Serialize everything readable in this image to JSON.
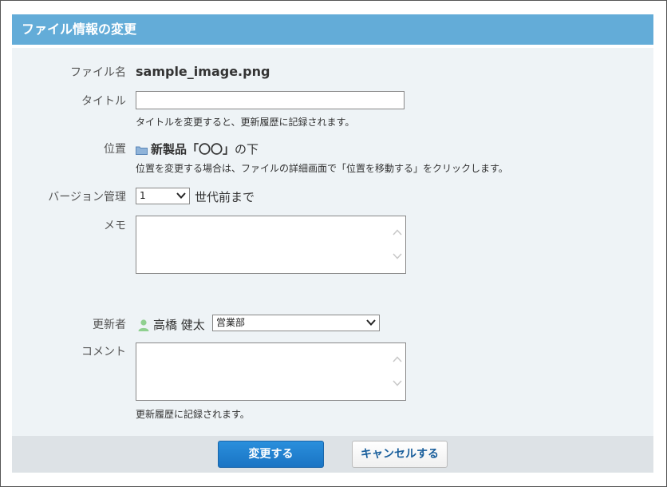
{
  "dialog": {
    "title": "ファイル情報の変更"
  },
  "form": {
    "filename_label": "ファイル名",
    "filename_value": "sample_image.png",
    "title_label": "タイトル",
    "title_value": "",
    "title_note": "タイトルを変更すると、更新履歴に記録されます。",
    "location_label": "位置",
    "location_name": "新製品「〇〇」",
    "location_suffix": "の下",
    "location_note": "位置を変更する場合は、ファイルの詳細画面で「位置を移動する」をクリックします。",
    "version_label": "バージョン管理",
    "version_value": "1",
    "version_suffix": "世代前まで",
    "memo_label": "メモ",
    "memo_value": "",
    "updater_label": "更新者",
    "updater_name": "高橋 健太",
    "department_value": "営業部",
    "comment_label": "コメント",
    "comment_value": "",
    "comment_note": "更新履歴に記録されます。"
  },
  "buttons": {
    "submit_label": "変更する",
    "cancel_label": "キャンセルする"
  },
  "icons": {
    "folder": "folder-icon",
    "user": "user-icon",
    "dropdown": "chevron-down-icon"
  },
  "colors": {
    "header": "#63acd8",
    "panel": "#eef3f6",
    "primary": "#1a74c4",
    "cancel_text": "#1a5f9c"
  }
}
